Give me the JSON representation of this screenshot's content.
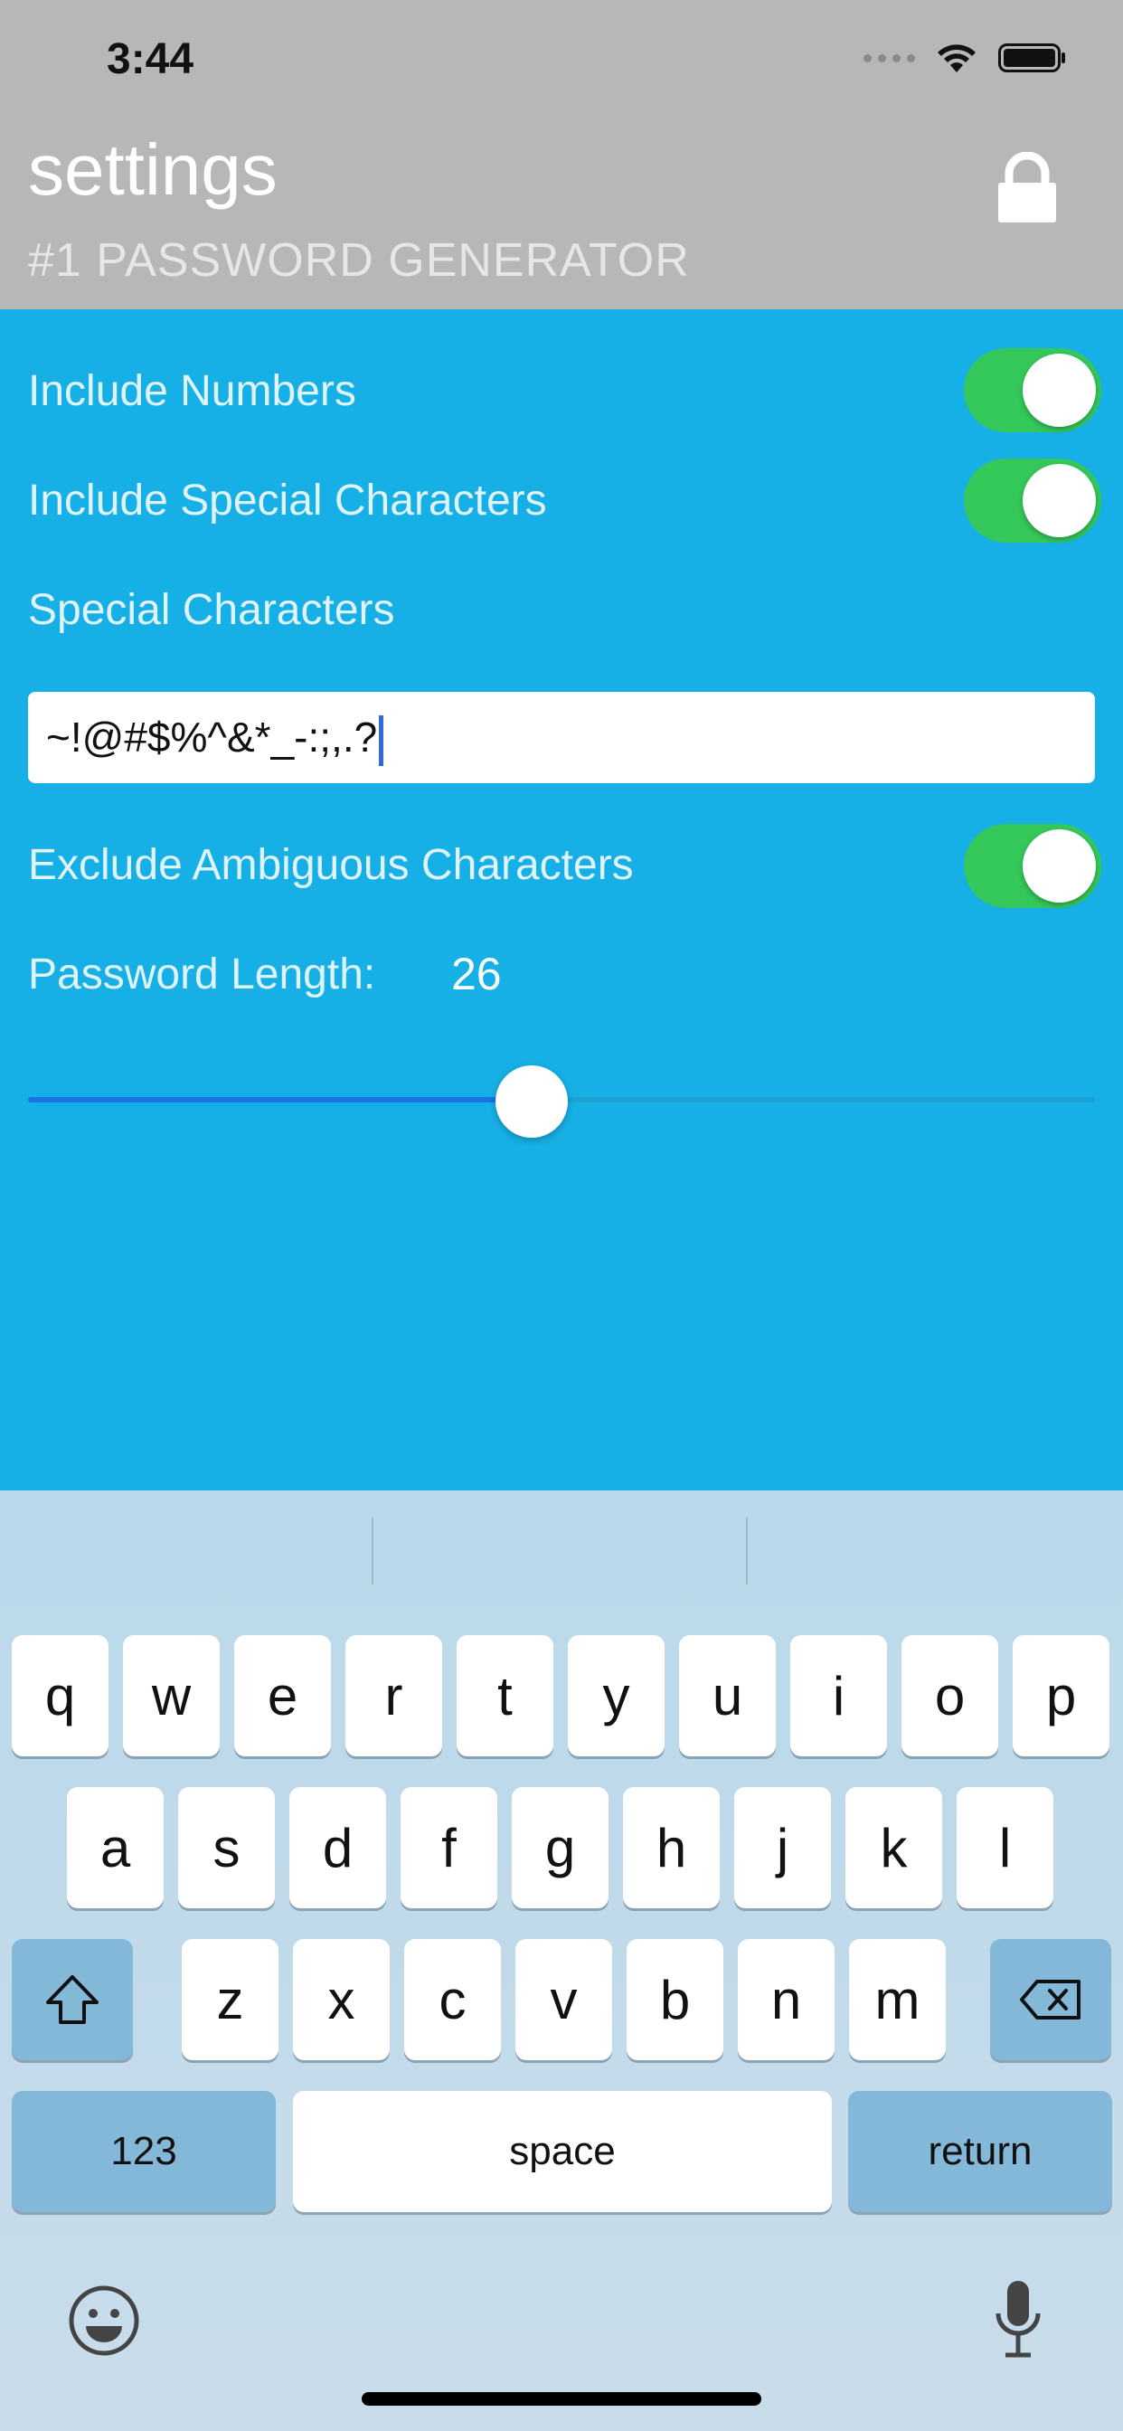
{
  "status_bar": {
    "time": "3:44"
  },
  "header": {
    "title": "settings",
    "subtitle": "#1 PASSWORD GENERATOR"
  },
  "settings": {
    "include_numbers": {
      "label": "Include Numbers",
      "on": true
    },
    "include_special": {
      "label": "Include Special Characters",
      "on": true
    },
    "special_chars_label": "Special Characters",
    "special_chars_value": "~!@#$%^&*_-:;,.?",
    "exclude_ambiguous": {
      "label": "Exclude Ambiguous Characters",
      "on": true
    },
    "password_length_label": "Password Length:",
    "password_length_value": "26",
    "slider_fraction": 0.47
  },
  "keyboard": {
    "row1": [
      "q",
      "w",
      "e",
      "r",
      "t",
      "y",
      "u",
      "i",
      "o",
      "p"
    ],
    "row2": [
      "a",
      "s",
      "d",
      "f",
      "g",
      "h",
      "j",
      "k",
      "l"
    ],
    "row3": [
      "z",
      "x",
      "c",
      "v",
      "b",
      "n",
      "m"
    ],
    "numbers_key": "123",
    "space_key": "space",
    "return_key": "return"
  },
  "colors": {
    "header_bg": "#b7b7b7",
    "content_bg": "#17b0e6",
    "toggle_on": "#34c759",
    "slider_fill": "#1a73e8"
  }
}
